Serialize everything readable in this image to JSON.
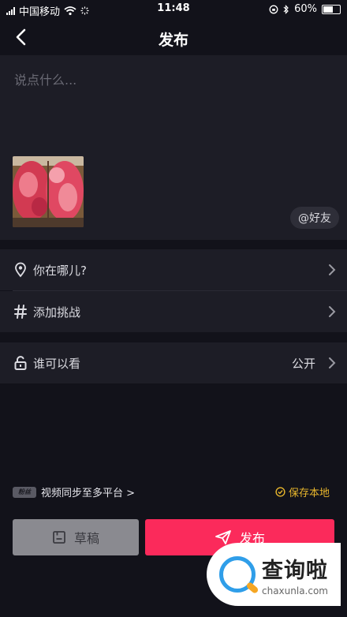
{
  "status_bar": {
    "carrier": "中国移动",
    "time": "11:48",
    "battery": "60%"
  },
  "header": {
    "title": "发布"
  },
  "compose": {
    "placeholder": "说点什么...",
    "friend_button": "@好友"
  },
  "options": {
    "location": "你在哪儿?",
    "challenge": "添加挑战",
    "visibility_label": "谁可以看",
    "visibility_value": "公开"
  },
  "footer": {
    "sync_badge": "粉丝",
    "sync_text": "视频同步至多平台 >",
    "save_local": "保存本地",
    "draft_button": "草稿",
    "publish_button": "发布"
  },
  "watermark": {
    "name": "查询啦",
    "domain": "chaxunla.com"
  },
  "colors": {
    "accent": "#fb2a5b",
    "save_local": "#e8b62c",
    "background": "#12121a",
    "panel": "#1d1d26"
  }
}
